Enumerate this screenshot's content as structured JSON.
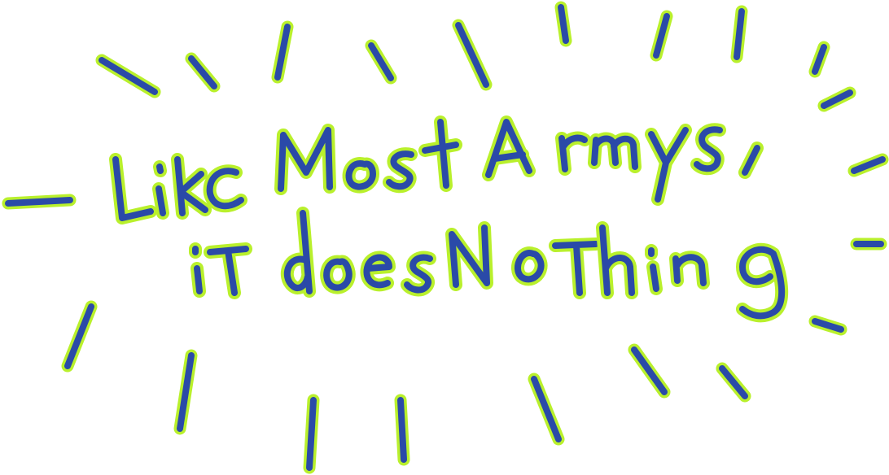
{
  "artwork": {
    "line1": "LiKC Most Armys,",
    "line2": "iT does NoThing",
    "colors": {
      "ink": "#2a4aa8",
      "glow": "#b9f02c",
      "background": "#ffffff"
    }
  }
}
